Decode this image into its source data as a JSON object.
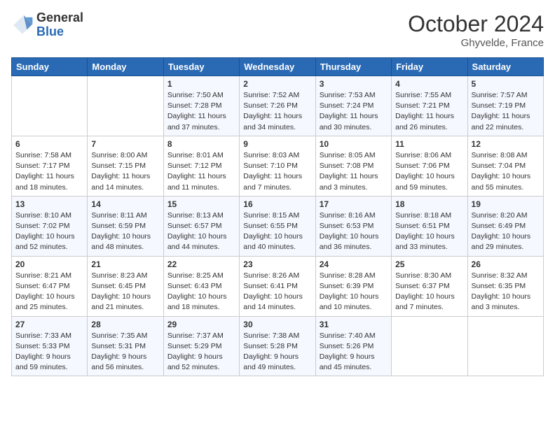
{
  "logo": {
    "general": "General",
    "blue": "Blue"
  },
  "title": "October 2024",
  "location": "Ghyvelde, France",
  "days_of_week": [
    "Sunday",
    "Monday",
    "Tuesday",
    "Wednesday",
    "Thursday",
    "Friday",
    "Saturday"
  ],
  "weeks": [
    [
      {
        "day": "",
        "info": ""
      },
      {
        "day": "",
        "info": ""
      },
      {
        "day": "1",
        "info": "Sunrise: 7:50 AM\nSunset: 7:28 PM\nDaylight: 11 hours\nand 37 minutes."
      },
      {
        "day": "2",
        "info": "Sunrise: 7:52 AM\nSunset: 7:26 PM\nDaylight: 11 hours\nand 34 minutes."
      },
      {
        "day": "3",
        "info": "Sunrise: 7:53 AM\nSunset: 7:24 PM\nDaylight: 11 hours\nand 30 minutes."
      },
      {
        "day": "4",
        "info": "Sunrise: 7:55 AM\nSunset: 7:21 PM\nDaylight: 11 hours\nand 26 minutes."
      },
      {
        "day": "5",
        "info": "Sunrise: 7:57 AM\nSunset: 7:19 PM\nDaylight: 11 hours\nand 22 minutes."
      }
    ],
    [
      {
        "day": "6",
        "info": "Sunrise: 7:58 AM\nSunset: 7:17 PM\nDaylight: 11 hours\nand 18 minutes."
      },
      {
        "day": "7",
        "info": "Sunrise: 8:00 AM\nSunset: 7:15 PM\nDaylight: 11 hours\nand 14 minutes."
      },
      {
        "day": "8",
        "info": "Sunrise: 8:01 AM\nSunset: 7:12 PM\nDaylight: 11 hours\nand 11 minutes."
      },
      {
        "day": "9",
        "info": "Sunrise: 8:03 AM\nSunset: 7:10 PM\nDaylight: 11 hours\nand 7 minutes."
      },
      {
        "day": "10",
        "info": "Sunrise: 8:05 AM\nSunset: 7:08 PM\nDaylight: 11 hours\nand 3 minutes."
      },
      {
        "day": "11",
        "info": "Sunrise: 8:06 AM\nSunset: 7:06 PM\nDaylight: 10 hours\nand 59 minutes."
      },
      {
        "day": "12",
        "info": "Sunrise: 8:08 AM\nSunset: 7:04 PM\nDaylight: 10 hours\nand 55 minutes."
      }
    ],
    [
      {
        "day": "13",
        "info": "Sunrise: 8:10 AM\nSunset: 7:02 PM\nDaylight: 10 hours\nand 52 minutes."
      },
      {
        "day": "14",
        "info": "Sunrise: 8:11 AM\nSunset: 6:59 PM\nDaylight: 10 hours\nand 48 minutes."
      },
      {
        "day": "15",
        "info": "Sunrise: 8:13 AM\nSunset: 6:57 PM\nDaylight: 10 hours\nand 44 minutes."
      },
      {
        "day": "16",
        "info": "Sunrise: 8:15 AM\nSunset: 6:55 PM\nDaylight: 10 hours\nand 40 minutes."
      },
      {
        "day": "17",
        "info": "Sunrise: 8:16 AM\nSunset: 6:53 PM\nDaylight: 10 hours\nand 36 minutes."
      },
      {
        "day": "18",
        "info": "Sunrise: 8:18 AM\nSunset: 6:51 PM\nDaylight: 10 hours\nand 33 minutes."
      },
      {
        "day": "19",
        "info": "Sunrise: 8:20 AM\nSunset: 6:49 PM\nDaylight: 10 hours\nand 29 minutes."
      }
    ],
    [
      {
        "day": "20",
        "info": "Sunrise: 8:21 AM\nSunset: 6:47 PM\nDaylight: 10 hours\nand 25 minutes."
      },
      {
        "day": "21",
        "info": "Sunrise: 8:23 AM\nSunset: 6:45 PM\nDaylight: 10 hours\nand 21 minutes."
      },
      {
        "day": "22",
        "info": "Sunrise: 8:25 AM\nSunset: 6:43 PM\nDaylight: 10 hours\nand 18 minutes."
      },
      {
        "day": "23",
        "info": "Sunrise: 8:26 AM\nSunset: 6:41 PM\nDaylight: 10 hours\nand 14 minutes."
      },
      {
        "day": "24",
        "info": "Sunrise: 8:28 AM\nSunset: 6:39 PM\nDaylight: 10 hours\nand 10 minutes."
      },
      {
        "day": "25",
        "info": "Sunrise: 8:30 AM\nSunset: 6:37 PM\nDaylight: 10 hours\nand 7 minutes."
      },
      {
        "day": "26",
        "info": "Sunrise: 8:32 AM\nSunset: 6:35 PM\nDaylight: 10 hours\nand 3 minutes."
      }
    ],
    [
      {
        "day": "27",
        "info": "Sunrise: 7:33 AM\nSunset: 5:33 PM\nDaylight: 9 hours\nand 59 minutes."
      },
      {
        "day": "28",
        "info": "Sunrise: 7:35 AM\nSunset: 5:31 PM\nDaylight: 9 hours\nand 56 minutes."
      },
      {
        "day": "29",
        "info": "Sunrise: 7:37 AM\nSunset: 5:29 PM\nDaylight: 9 hours\nand 52 minutes."
      },
      {
        "day": "30",
        "info": "Sunrise: 7:38 AM\nSunset: 5:28 PM\nDaylight: 9 hours\nand 49 minutes."
      },
      {
        "day": "31",
        "info": "Sunrise: 7:40 AM\nSunset: 5:26 PM\nDaylight: 9 hours\nand 45 minutes."
      },
      {
        "day": "",
        "info": ""
      },
      {
        "day": "",
        "info": ""
      }
    ]
  ]
}
